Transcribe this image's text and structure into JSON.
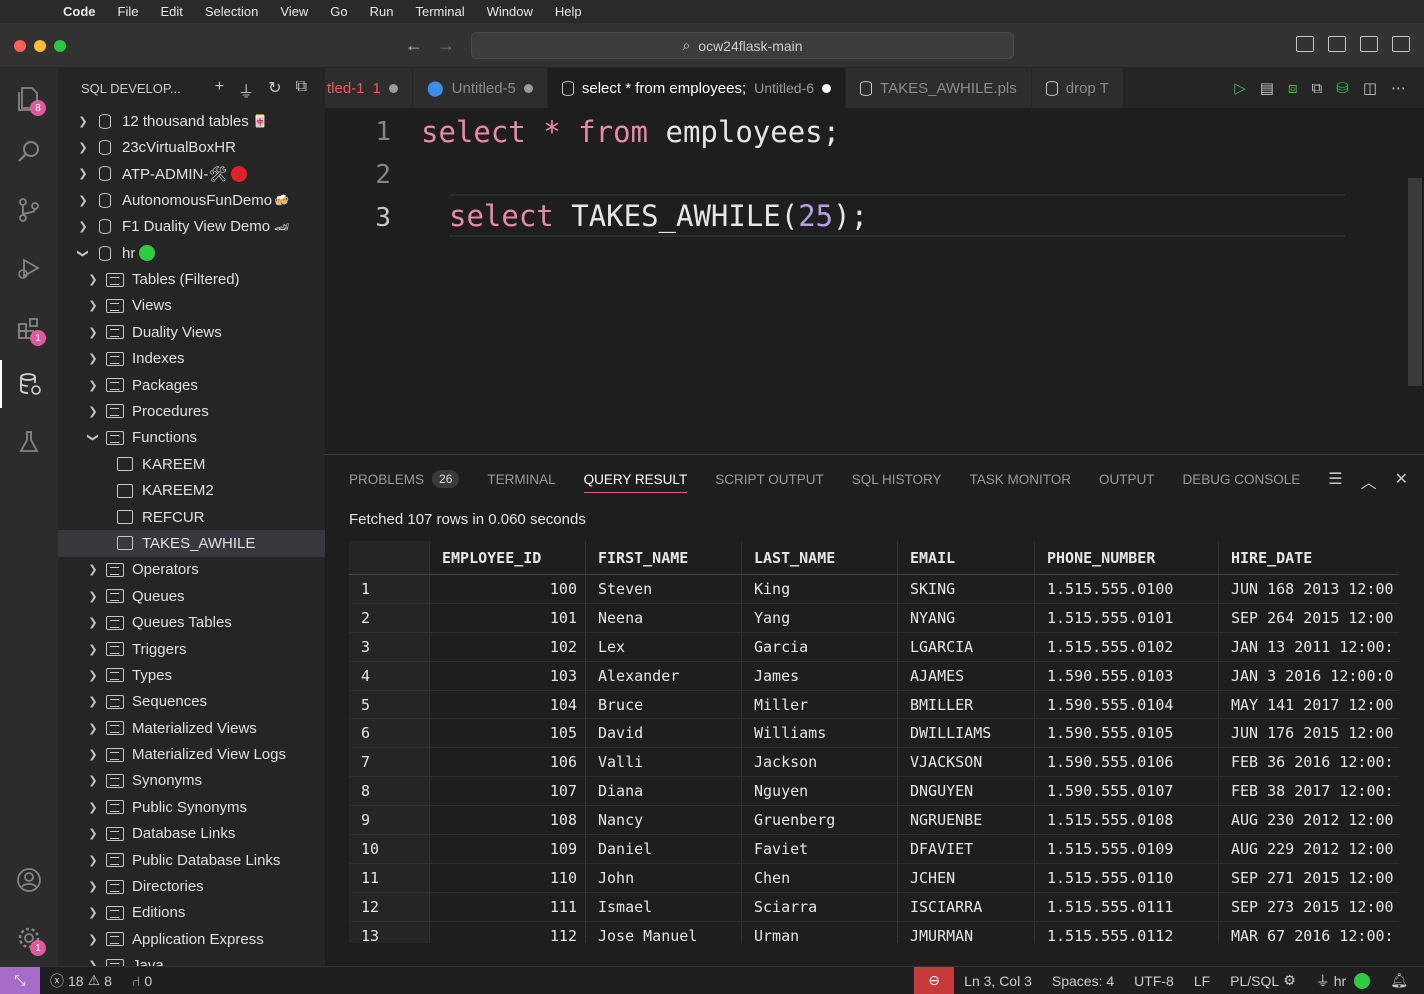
{
  "menubar": {
    "apple": "",
    "items": [
      "Code",
      "File",
      "Edit",
      "Selection",
      "View",
      "Go",
      "Run",
      "Terminal",
      "Window",
      "Help"
    ]
  },
  "titlebar": {
    "search_text": "ocw24flask-main"
  },
  "activity": {
    "explorer_badge": "8",
    "extensions_badge": "1",
    "settings_badge": "1"
  },
  "sidebar": {
    "title": "SQL DEVELOP...",
    "connections": [
      {
        "label": "12 thousand tables",
        "emoji": "🀄"
      },
      {
        "label": "23cVirtualBoxHR",
        "emoji": ""
      },
      {
        "label": "ATP-ADMIN-🛠",
        "emoji": ""
      },
      {
        "label": "AutonomousFunDemo",
        "emoji": "🍻"
      },
      {
        "label": "F1 Duality View Demo",
        "emoji": "🏎"
      }
    ],
    "hr_label": "hr",
    "hr_children": [
      "Tables (Filtered)",
      "Views",
      "Duality Views",
      "Indexes",
      "Packages",
      "Procedures",
      "Functions"
    ],
    "functions": [
      "KAREEM",
      "KAREEM2",
      "REFCUR",
      "TAKES_AWHILE"
    ],
    "after_functions": [
      "Operators",
      "Queues",
      "Queues Tables",
      "Triggers",
      "Types",
      "Sequences",
      "Materialized Views",
      "Materialized View Logs",
      "Synonyms",
      "Public Synonyms",
      "Database Links",
      "Public Database Links",
      "Directories",
      "Editions",
      "Application Express",
      "Java"
    ]
  },
  "tabs": {
    "t1": "tled-1",
    "t1_count": "1",
    "t2": "Untitled-5",
    "t3": "select * from employees;",
    "t3_desc": "Untitled-6",
    "t4": "TAKES_AWHILE.pls",
    "t5": "drop T"
  },
  "editor": {
    "lines": [
      {
        "n": "1",
        "kw1": "select",
        "op": "*",
        "kw2": "from",
        "id": "employees;"
      },
      {
        "n": "2"
      },
      {
        "n": "3",
        "kw1": "select",
        "id": "TAKES_AWHILE(",
        "num": "25",
        "tail": ");"
      }
    ]
  },
  "panel": {
    "tabs": [
      "PROBLEMS",
      "TERMINAL",
      "QUERY RESULT",
      "SCRIPT OUTPUT",
      "SQL HISTORY",
      "TASK MONITOR",
      "OUTPUT",
      "DEBUG CONSOLE"
    ],
    "problems_count": "26",
    "fetched": "Fetched 107 rows in 0.060 seconds"
  },
  "grid": {
    "columns": [
      "",
      "EMPLOYEE_ID",
      "FIRST_NAME",
      "LAST_NAME",
      "EMAIL",
      "PHONE_NUMBER",
      "HIRE_DATE"
    ],
    "rows": [
      [
        "1",
        "100",
        "Steven",
        "King",
        "SKING",
        "1.515.555.0100",
        "JUN 168 2013 12:00"
      ],
      [
        "2",
        "101",
        "Neena",
        "Yang",
        "NYANG",
        "1.515.555.0101",
        "SEP 264 2015 12:00"
      ],
      [
        "3",
        "102",
        "Lex",
        "Garcia",
        "LGARCIA",
        "1.515.555.0102",
        "JAN 13 2011 12:00:"
      ],
      [
        "4",
        "103",
        "Alexander",
        "James",
        "AJAMES",
        "1.590.555.0103",
        "JAN 3 2016 12:00:0"
      ],
      [
        "5",
        "104",
        "Bruce",
        "Miller",
        "BMILLER",
        "1.590.555.0104",
        "MAY 141 2017 12:00"
      ],
      [
        "6",
        "105",
        "David",
        "Williams",
        "DWILLIAMS",
        "1.590.555.0105",
        "JUN 176 2015 12:00"
      ],
      [
        "7",
        "106",
        "Valli",
        "Jackson",
        "VJACKSON",
        "1.590.555.0106",
        "FEB 36 2016 12:00:"
      ],
      [
        "8",
        "107",
        "Diana",
        "Nguyen",
        "DNGUYEN",
        "1.590.555.0107",
        "FEB 38 2017 12:00:"
      ],
      [
        "9",
        "108",
        "Nancy",
        "Gruenberg",
        "NGRUENBE",
        "1.515.555.0108",
        "AUG 230 2012 12:00"
      ],
      [
        "10",
        "109",
        "Daniel",
        "Faviet",
        "DFAVIET",
        "1.515.555.0109",
        "AUG 229 2012 12:00"
      ],
      [
        "11",
        "110",
        "John",
        "Chen",
        "JCHEN",
        "1.515.555.0110",
        "SEP 271 2015 12:00"
      ],
      [
        "12",
        "111",
        "Ismael",
        "Sciarra",
        "ISCIARRA",
        "1.515.555.0111",
        "SEP 273 2015 12:00"
      ],
      [
        "13",
        "112",
        "Jose Manuel",
        "Urman",
        "JMURMAN",
        "1.515.555.0112",
        "MAR 67 2016 12:00:"
      ]
    ]
  },
  "status": {
    "errors": "18",
    "warnings": "8",
    "ports": "0",
    "position": "Ln 3, Col 3",
    "spaces": "Spaces: 4",
    "encoding": "UTF-8",
    "eol": "LF",
    "language": "PL/SQL",
    "connection": "hr"
  },
  "colors": {
    "accent": "#e05a9a",
    "keyword": "#e88aa6",
    "number": "#b5a1e0",
    "remote": "#a66cc8",
    "zoom_alert": "#c83a3a"
  }
}
